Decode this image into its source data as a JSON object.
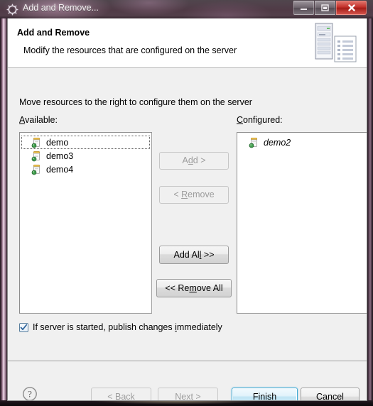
{
  "window": {
    "title": "Add and Remove...",
    "icon": "gear-icon",
    "controls": {
      "minimize": "minimize-icon",
      "maximize": "maximize-icon",
      "close": "close-icon"
    }
  },
  "header": {
    "title": "Add and Remove",
    "description": "Modify the resources that are configured on the server",
    "banner_icon": "server-document-icon"
  },
  "body": {
    "instruction": "Move resources to the right to configure them on the server",
    "available": {
      "label_prefix": "A",
      "label_rest": "vailable:",
      "items": [
        {
          "name": "demo",
          "icon": "jar-module-icon",
          "focused": true,
          "italic": false
        },
        {
          "name": "demo3",
          "icon": "jar-module-icon",
          "focused": false,
          "italic": false
        },
        {
          "name": "demo4",
          "icon": "jar-module-icon",
          "focused": false,
          "italic": false
        }
      ]
    },
    "configured": {
      "label_prefix": "C",
      "label_rest": "onfigured:",
      "items": [
        {
          "name": "demo2",
          "icon": "jar-module-icon",
          "focused": false,
          "italic": true
        }
      ]
    },
    "transfer_buttons": {
      "add": {
        "pre": "A",
        "mnemonic": "d",
        "post": "d >",
        "enabled": false
      },
      "remove": {
        "pre": "< ",
        "mnemonic": "R",
        "post": "emove",
        "enabled": false
      },
      "add_all": {
        "pre": "Add Al",
        "mnemonic": "l",
        "post": " >>",
        "enabled": true
      },
      "remove_all": {
        "pre": "<< Re",
        "mnemonic": "m",
        "post": "ove All",
        "enabled": true
      }
    },
    "checkbox": {
      "checked": true,
      "pre": "If server is started, publish changes ",
      "mnemonic": "i",
      "post": "mmediately"
    }
  },
  "footer": {
    "help_icon": "help-question-icon",
    "buttons": {
      "back": {
        "pre": "< ",
        "mnemonic": "B",
        "post": "ack",
        "enabled": false,
        "default": false
      },
      "next": {
        "pre": "",
        "mnemonic": "N",
        "post": "ext >",
        "enabled": false,
        "default": false
      },
      "finish": {
        "pre": "",
        "mnemonic": "F",
        "post": "inish",
        "enabled": true,
        "default": true
      },
      "cancel": {
        "pre": "Cancel",
        "mnemonic": "",
        "post": "",
        "enabled": true,
        "default": false
      }
    }
  },
  "colors": {
    "dialog_bg": "#f0f0f0",
    "header_bg": "#ffffff",
    "listbox_bg": "#ffffff",
    "default_button_border": "#3fa9d4",
    "close_button": "#c2302a",
    "checkbox_check": "#2a6099"
  }
}
